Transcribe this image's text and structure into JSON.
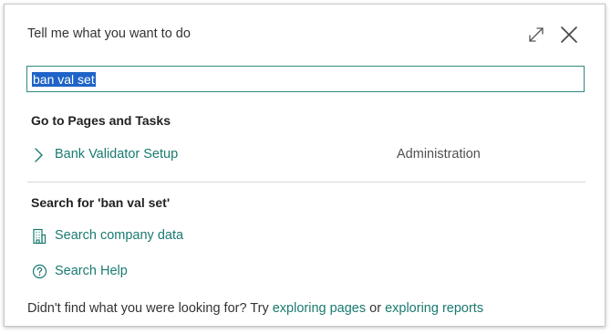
{
  "dialog": {
    "title": "Tell me what you want to do",
    "expand_icon": "expand-icon",
    "close_icon": "close-icon"
  },
  "search": {
    "value": "ban val set"
  },
  "pages_section": {
    "heading": "Go to Pages and Tasks",
    "results": [
      {
        "label": "Bank Validator Setup",
        "category": "Administration",
        "icon": "chevron-right-icon"
      }
    ]
  },
  "search_section": {
    "heading": "Search for 'ban val set'",
    "actions": [
      {
        "label": "Search company data",
        "icon": "building-icon"
      },
      {
        "label": "Search Help",
        "icon": "help-icon"
      }
    ]
  },
  "footer": {
    "prefix": "Didn't find what you were looking for? Try ",
    "link1": "exploring pages",
    "middle": " or ",
    "link2": "exploring reports"
  },
  "colors": {
    "accent": "#1a7a70",
    "selection": "#1e63c7",
    "border_focus": "#2f8a80"
  }
}
